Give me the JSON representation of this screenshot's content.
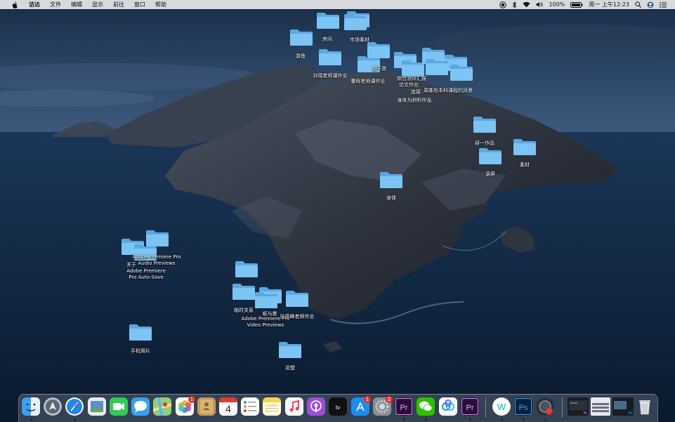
{
  "menubar": {
    "app_name": "访达",
    "items": [
      "文件",
      "编辑",
      "显示",
      "前往",
      "窗口",
      "帮助"
    ],
    "battery": "100%",
    "clock": "周一 上午12:23"
  },
  "desktop": {
    "labels": {
      "fangjian": "房间",
      "youyu": "游鱼",
      "shichang": "市场素材",
      "sunyao": "孙瑶老师课作业",
      "caohui": "曹晖老师课作业",
      "wobuwoshi": "我不是",
      "zonghe": "综合测评汇报",
      "lunwen": "论文作业",
      "lianjie": "连接",
      "shenti_cailiao": "身体为材料作品",
      "zhoushi": "周姝彤本科课程的风景",
      "yanyi": "研一作品",
      "sucai": "素材",
      "luping": "录屏",
      "shenti": "身体",
      "adobe_audio": "Adobe Premiere Pro Audio Previews",
      "guanyu": "关于",
      "adobe_autosave": "Adobe Premiere Pro Auto-Save",
      "linshi": "临时关系",
      "zhiyu": "纸与墨",
      "adobe_video": "Adobe Premiere Pro Video Previews",
      "zhangdefeng": "张德峰老师作业",
      "shouji": "手机照片",
      "nisu": "泥塑"
    }
  },
  "dock": {
    "badges": {
      "photos": "1",
      "appstore": "1",
      "prefs": "2",
      "premiere_pro": "1"
    },
    "calendar_day": "4"
  },
  "colors": {
    "menubar_bg": "#e6e8ec",
    "folder_blue": "#7cc4f4",
    "folder_tab": "#5ba8e0",
    "badge_red": "#e8322a"
  }
}
